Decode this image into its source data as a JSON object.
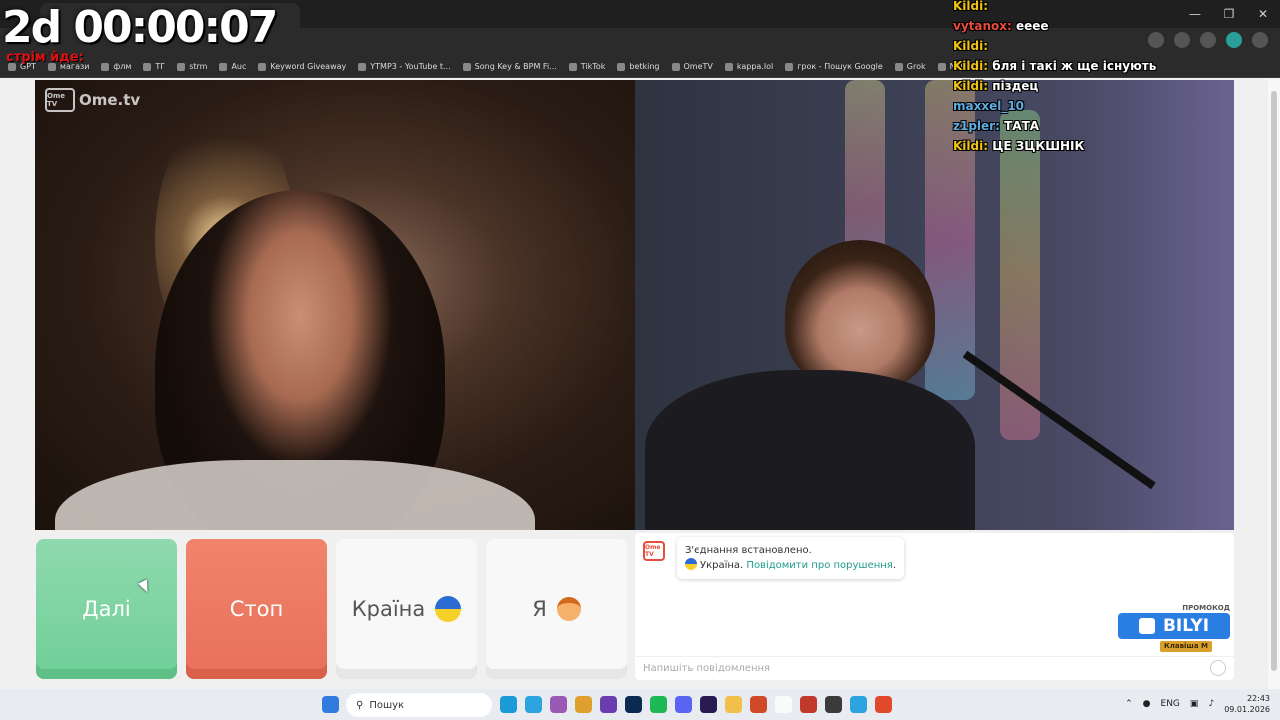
{
  "overlay": {
    "timer": "2d 00:00:07",
    "timer_sub": "стрім йде:"
  },
  "bookmarks": [
    "GPT",
    "магази",
    "флм",
    "ТГ",
    "strm",
    "Auc",
    "Keyword Giveaway",
    "YTMP3 - YouTube t...",
    "Song Key & BPM Fi...",
    "TikTok",
    "betking",
    "OmeTV",
    "kappa.lol",
    "грок - Пошук Google",
    "Grok",
    "NektoMe"
  ],
  "stream_chat": [
    {
      "user": "Kildi:",
      "text": ""
    },
    {
      "user": "vytanox:",
      "text": "eeee"
    },
    {
      "user": "Kildi:",
      "text": ""
    },
    {
      "user": "Kildi:",
      "text": "бля і такі ж ще існують"
    },
    {
      "user": "Kildi:",
      "text": "піздец"
    },
    {
      "user": "maxxel_10",
      "text": ""
    },
    {
      "user": "z1pler:",
      "text": "ТАТА"
    },
    {
      "user": "Kildi:",
      "text": "ЦЕ ЗЦКШНІК"
    }
  ],
  "site": {
    "logo": "Ome.tv",
    "logo_box": "Ome TV"
  },
  "controls": {
    "next_label": "Далі",
    "stop_label": "Стоп",
    "country_label": "Країна",
    "me_label": "Я"
  },
  "chat": {
    "icon_text": "Ome TV",
    "connected": "З'єднання встановлено.",
    "country": "Україна.",
    "report_link": "Повідомити про порушення",
    "report_end": ".",
    "input_placeholder": "Напишіть повідомлення"
  },
  "promo": {
    "label": "ПРОМОКОД",
    "code": "BILYI",
    "key_label": "Клавіша",
    "key": "M"
  },
  "taskbar": {
    "search": "Пошук",
    "lang": "ENG",
    "time": "22:43",
    "date": "09.01.2026"
  },
  "colors": {
    "next": "#6fcf97",
    "stop": "#e8705a",
    "link": "#1f9c8c",
    "promo": "#2a7de1"
  }
}
